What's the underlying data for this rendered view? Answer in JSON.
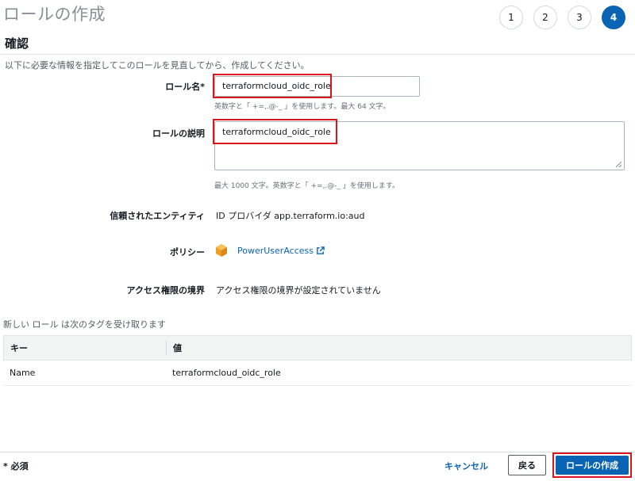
{
  "page": {
    "title": "ロールの作成",
    "section_title": "確認",
    "intro": "以下に必要な情報を指定してこのロールを見直してから、作成してください。"
  },
  "steps": [
    "1",
    "2",
    "3",
    "4"
  ],
  "active_step": "4",
  "form": {
    "role_name": {
      "label": "ロール名*",
      "value": "terraformcloud_oidc_role",
      "hint": "英数字と「 +=,.@-_ 」を使用します。最大 64 文字。"
    },
    "role_description": {
      "label": "ロールの説明",
      "value": "terraformcloud_oidc_role",
      "hint": "最大 1000 文字。英数字と「 +=,.@-_ 」を使用します。"
    },
    "trusted_entity": {
      "label": "信頼されたエンティティ",
      "value": "ID プロバイダ app.terraform.io:aud"
    },
    "policy": {
      "label": "ポリシー",
      "link": "PowerUserAccess"
    },
    "permissions_boundary": {
      "label": "アクセス権限の境界",
      "value": "アクセス権限の境界が設定されていません"
    }
  },
  "tags": {
    "caption": "新しい ロール は次のタグを受け取ります",
    "headers": [
      "キー",
      "値"
    ],
    "rows": [
      [
        "Name",
        "terraformcloud_oidc_role"
      ]
    ]
  },
  "footer": {
    "required_note": "* 必須",
    "cancel_label": "キャンセル",
    "back_label": "戻る",
    "create_label": "ロールの作成"
  },
  "colors": {
    "primary": "#0a64b4",
    "highlight": "#d9161f",
    "policy_icon": "#f0a020"
  },
  "icons": {
    "policy": "aws-policy-cube-icon",
    "external": "external-link-icon"
  }
}
